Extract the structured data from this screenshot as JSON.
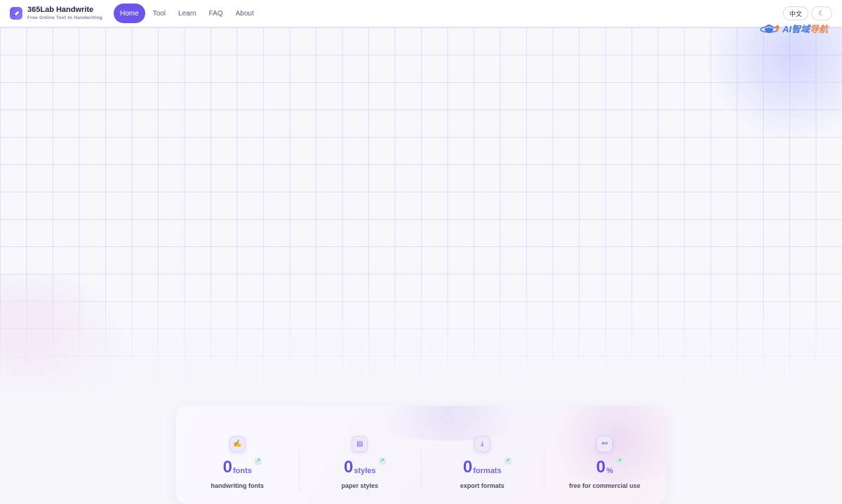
{
  "brand": {
    "title": "365Lab Handwrite",
    "subtitle": "Free Online Text to Handwriting",
    "logo_icon": "pen-icon"
  },
  "nav": {
    "items": [
      {
        "label": "Home",
        "active": true
      },
      {
        "label": "Tool",
        "active": false
      },
      {
        "label": "Learn",
        "active": false
      },
      {
        "label": "FAQ",
        "active": false
      },
      {
        "label": "About",
        "active": false
      }
    ]
  },
  "header": {
    "lang_label": "中文",
    "theme_icon": "☾"
  },
  "watermark": {
    "text_part1": "AI智域",
    "text_part2": "导航",
    "icon": "globe-icon"
  },
  "stats": [
    {
      "icon": "signature-icon",
      "icon_glyph": "✍",
      "value": "0",
      "unit": "fonts",
      "label": "handwriting fonts",
      "trend_icon": "trend-up-icon"
    },
    {
      "icon": "paper-icon",
      "icon_glyph": "▤",
      "value": "0",
      "unit": "styles",
      "label": "paper styles",
      "trend_icon": "trend-up-icon"
    },
    {
      "icon": "download-icon",
      "icon_glyph": "⤓",
      "value": "0",
      "unit": "formats",
      "label": "export formats",
      "trend_icon": "trend-up-icon"
    },
    {
      "icon": "handshake-icon",
      "icon_glyph": "⚯",
      "value": "0",
      "unit": "%",
      "label": "free for commercial use",
      "trend_icon": "trend-up-icon"
    }
  ],
  "colors": {
    "accent": "#6a57e8",
    "stat_number": "#6153d6",
    "trend_bg": "#d8eee8"
  }
}
